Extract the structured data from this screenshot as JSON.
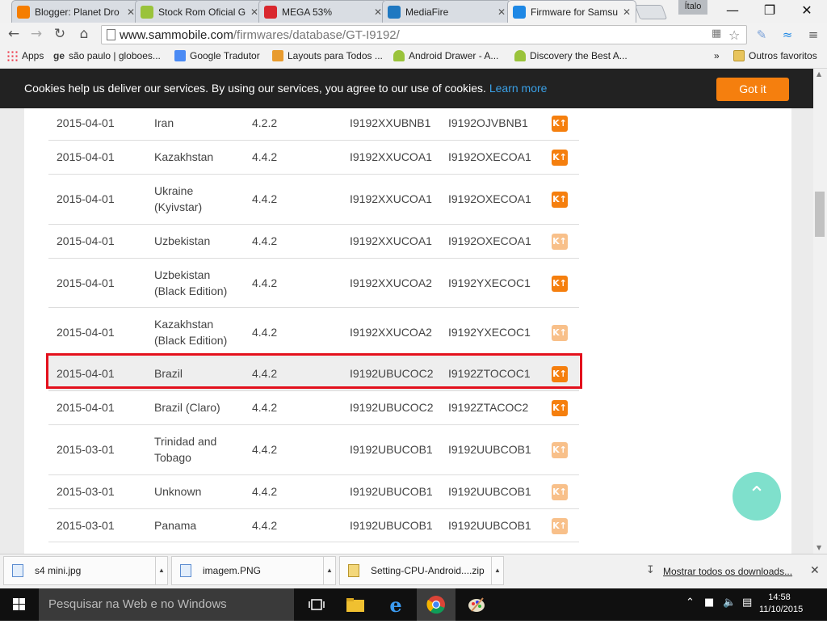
{
  "tabs": [
    {
      "title": "Blogger: Planet Dro",
      "icon": "blogger-icon",
      "color": "#f57d00"
    },
    {
      "title": "Stock Rom Oficial G",
      "icon": "android-icon",
      "color": "#9ac33b"
    },
    {
      "title": "MEGA 53%",
      "icon": "mega-icon",
      "color": "#d9272e"
    },
    {
      "title": "MediaFire",
      "icon": "mediafire-icon",
      "color": "#1f78c1"
    },
    {
      "title": "Firmware for Samsu",
      "icon": "sammobile-icon",
      "color": "#1e88e5"
    }
  ],
  "profile_name": "Ítalo",
  "address": {
    "host": "www.sammobile.com",
    "path": "/firmwares/database/GT-I9192/"
  },
  "bookmarks": [
    {
      "label": "Apps",
      "icon": "apps-grid-icon"
    },
    {
      "label": "são paulo | globoes...",
      "icon": "globo-icon"
    },
    {
      "label": "Google Tradutor",
      "icon": "translate-icon"
    },
    {
      "label": "Layouts para Todos ...",
      "icon": "layouts-icon"
    },
    {
      "label": "Android Drawer - A...",
      "icon": "android-icon"
    },
    {
      "label": "Discovery the Best A...",
      "icon": "android-icon"
    }
  ],
  "bookmarks_overflow": "»",
  "other_bookmarks": "Outros favoritos",
  "cookie": {
    "message": "Cookies help us deliver our services. By using our services, you agree to our use of cookies.",
    "learn_more": "Learn more",
    "button": "Got it"
  },
  "firmware_rows": [
    {
      "date": "2015-04-01",
      "region": "Iran",
      "region2": "",
      "version": "4.2.2",
      "pda": "I9192XXUBNB1",
      "csc": "I9192OJVBNB1",
      "badge": "K↑",
      "badge_style": "solid"
    },
    {
      "date": "2015-04-01",
      "region": "Kazakhstan",
      "region2": "",
      "version": "4.4.2",
      "pda": "I9192XXUCOA1",
      "csc": "I9192OXECOA1",
      "badge": "K↑",
      "badge_style": "solid"
    },
    {
      "date": "2015-04-01",
      "region": "Ukraine",
      "region2": "(Kyivstar)",
      "version": "4.4.2",
      "pda": "I9192XXUCOA1",
      "csc": "I9192OXECOA1",
      "badge": "K↑",
      "badge_style": "solid"
    },
    {
      "date": "2015-04-01",
      "region": "Uzbekistan",
      "region2": "",
      "version": "4.4.2",
      "pda": "I9192XXUCOA1",
      "csc": "I9192OXECOA1",
      "badge": "K↑",
      "badge_style": "light"
    },
    {
      "date": "2015-04-01",
      "region": "Uzbekistan",
      "region2": "(Black Edition)",
      "version": "4.4.2",
      "pda": "I9192XXUCOA2",
      "csc": "I9192YXECOC1",
      "badge": "K↑",
      "badge_style": "solid"
    },
    {
      "date": "2015-04-01",
      "region": "Kazakhstan",
      "region2": "(Black Edition)",
      "version": "4.4.2",
      "pda": "I9192XXUCOA2",
      "csc": "I9192YXECOC1",
      "badge": "K↑",
      "badge_style": "light"
    },
    {
      "date": "2015-04-01",
      "region": "Brazil",
      "region2": "",
      "version": "4.4.2",
      "pda": "I9192UBUCOC2",
      "csc": "I9192ZTOCOC1",
      "badge": "K↑",
      "badge_style": "solid",
      "highlighted": true
    },
    {
      "date": "2015-04-01",
      "region": "Brazil (Claro)",
      "region2": "",
      "version": "4.4.2",
      "pda": "I9192UBUCOC2",
      "csc": "I9192ZTACOC2",
      "badge": "K↑",
      "badge_style": "solid"
    },
    {
      "date": "2015-03-01",
      "region": "Trinidad and",
      "region2": "Tobago",
      "version": "4.4.2",
      "pda": "I9192UBUCOB1",
      "csc": "I9192UUBCOB1",
      "badge": "K↑",
      "badge_style": "light"
    },
    {
      "date": "2015-03-01",
      "region": "Unknown",
      "region2": "",
      "version": "4.4.2",
      "pda": "I9192UBUCOB1",
      "csc": "I9192UUBCOB1",
      "badge": "K↑",
      "badge_style": "light"
    },
    {
      "date": "2015-03-01",
      "region": "Panama",
      "region2": "",
      "version": "4.4.2",
      "pda": "I9192UBUCOB1",
      "csc": "I9192UUBCOB1",
      "badge": "K↑",
      "badge_style": "light"
    }
  ],
  "downloads": [
    {
      "name": "s4 mini.jpg",
      "icon": "image-file-icon"
    },
    {
      "name": "imagem.PNG",
      "icon": "image-file-icon"
    },
    {
      "name": "Setting-CPU-Android....zip",
      "icon": "zip-file-icon"
    }
  ],
  "show_all_downloads": "Mostrar todos os downloads...",
  "taskbar": {
    "search_placeholder": "Pesquisar na Web e no Windows",
    "time": "14:58",
    "date": "11/10/2015"
  },
  "colors": {
    "accent_orange": "#f57f0e",
    "highlight_border": "#e3101c",
    "scrolltop": "#7fe0cc"
  }
}
